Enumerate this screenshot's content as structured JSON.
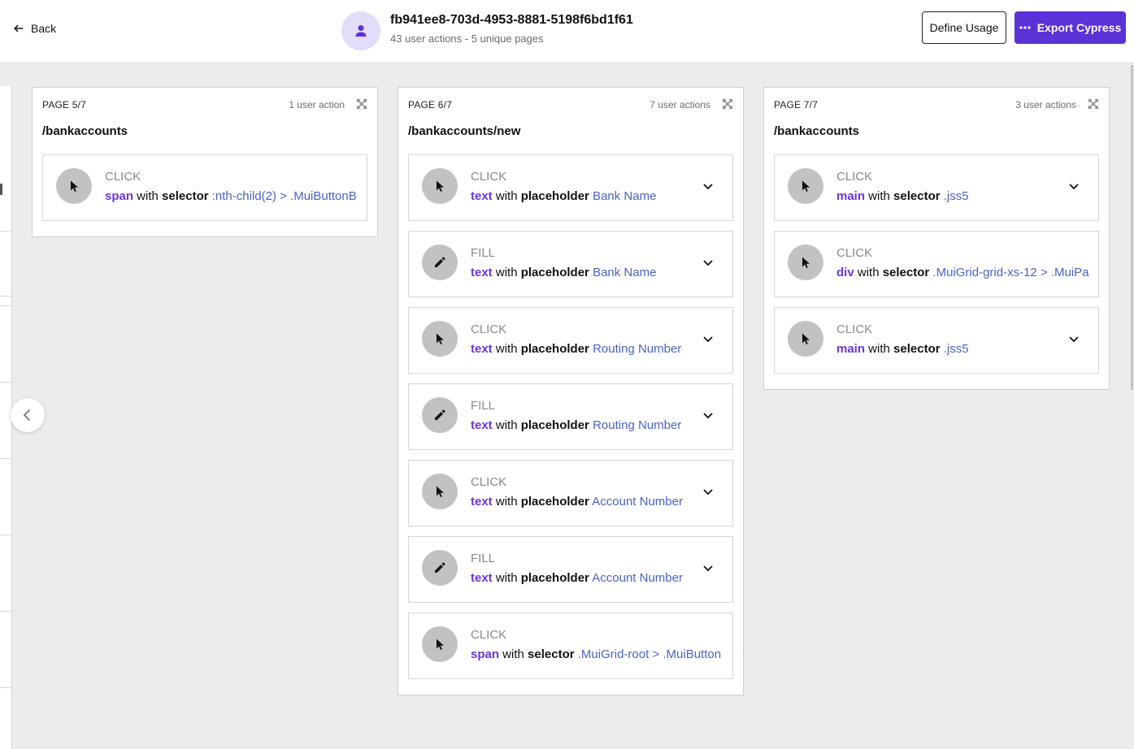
{
  "header": {
    "back_label": "Back",
    "session_id": "fb941ee8-703d-4953-8881-5198f6bd1f61",
    "summary": "43 user actions - 5 unique pages",
    "define_usage_label": "Define Usage",
    "export_label": "Export Cypress"
  },
  "pages": [
    {
      "label": "PAGE 5/7",
      "count": "1 user action",
      "path": "/bankaccounts",
      "actions": [
        {
          "type": "CLICK",
          "element": "span",
          "with": "with",
          "key": "selector",
          "value": ":nth-child(2) > .MuiButtonB"
        }
      ]
    },
    {
      "label": "PAGE 6/7",
      "count": "7 user actions",
      "path": "/bankaccounts/new",
      "actions": [
        {
          "type": "CLICK",
          "element": "text",
          "with": "with",
          "key": "placeholder",
          "value": "Bank Name"
        },
        {
          "type": "FILL",
          "element": "text",
          "with": "with",
          "key": "placeholder",
          "value": "Bank Name"
        },
        {
          "type": "CLICK",
          "element": "text",
          "with": "with",
          "key": "placeholder",
          "value": "Routing Number"
        },
        {
          "type": "FILL",
          "element": "text",
          "with": "with",
          "key": "placeholder",
          "value": "Routing Number"
        },
        {
          "type": "CLICK",
          "element": "text",
          "with": "with",
          "key": "placeholder",
          "value": "Account Number"
        },
        {
          "type": "FILL",
          "element": "text",
          "with": "with",
          "key": "placeholder",
          "value": "Account Number"
        },
        {
          "type": "CLICK",
          "element": "span",
          "with": "with",
          "key": "selector",
          "value": ".MuiGrid-root > .MuiButton"
        }
      ]
    },
    {
      "label": "PAGE 7/7",
      "count": "3 user actions",
      "path": "/bankaccounts",
      "actions": [
        {
          "type": "CLICK",
          "element": "main",
          "with": "with",
          "key": "selector",
          "value": ".jss5"
        },
        {
          "type": "CLICK",
          "element": "div",
          "with": "with",
          "key": "selector",
          "value": ".MuiGrid-grid-xs-12 > .MuiPa"
        },
        {
          "type": "CLICK",
          "element": "main",
          "with": "with",
          "key": "selector",
          "value": ".jss5"
        }
      ]
    }
  ],
  "icons": {
    "back": "arrow-left-icon",
    "user": "user-icon",
    "export": "dots-icon",
    "expand": "expand-icon",
    "click": "cursor-icon",
    "fill": "pencil-icon",
    "chevron": "chevron-down-icon",
    "prev": "chevron-left-icon"
  },
  "colors": {
    "accent": "#5b32d6",
    "element": "#6a36e0",
    "value": "#4a63c7",
    "avatar_bg": "#e3dcfb"
  }
}
